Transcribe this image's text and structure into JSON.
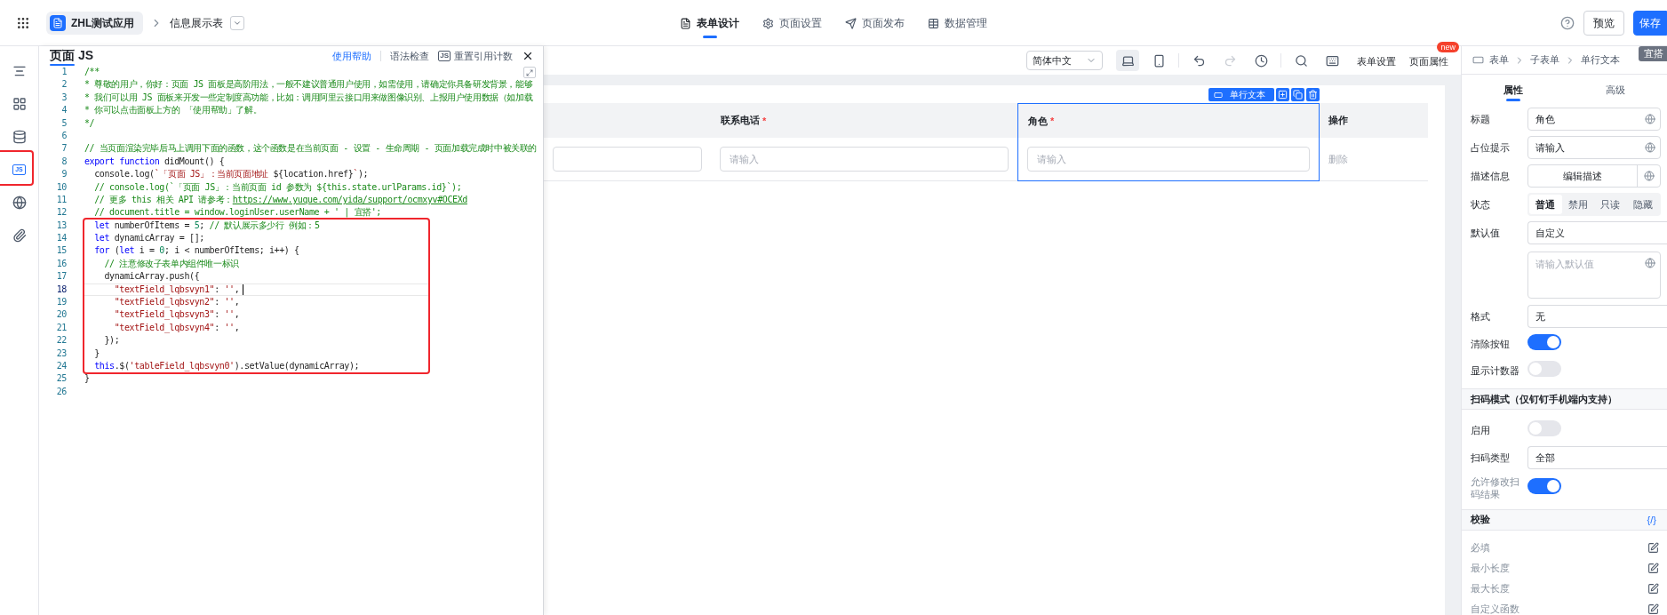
{
  "top_bar": {
    "app_name": "ZHL测试应用",
    "page_name": "信息展示表",
    "nav_tabs": [
      {
        "label": "表单设计",
        "selected": true
      },
      {
        "label": "页面设置",
        "selected": false
      },
      {
        "label": "页面发布",
        "selected": false
      },
      {
        "label": "数据管理",
        "selected": false
      }
    ],
    "buttons": [
      {
        "label": "预览",
        "kind": "secondary"
      },
      {
        "label": "保存",
        "kind": "primary"
      }
    ],
    "tag": "宜搭"
  },
  "rail": [
    {
      "kind": "outline",
      "selected": false,
      "highlighted": false
    },
    {
      "kind": "components",
      "selected": false,
      "highlighted": false
    },
    {
      "kind": "datasource",
      "selected": false,
      "highlighted": false
    },
    {
      "kind": "js",
      "label": "JS",
      "selected": true,
      "highlighted": true
    },
    {
      "kind": "i18n",
      "selected": false,
      "highlighted": false
    },
    {
      "kind": "attachment",
      "selected": false,
      "highlighted": false
    }
  ],
  "code_panel": {
    "title": "页面 JS",
    "actions": [
      {
        "kind": "link",
        "label": "使用帮助"
      },
      {
        "kind": "button",
        "label": "语法检查"
      },
      {
        "kind": "icon_button",
        "label": "重置引用计数",
        "icon_text": "JS"
      },
      {
        "kind": "close"
      }
    ],
    "lines": [
      {
        "number": "1",
        "boxed": false,
        "current": false,
        "tokens": [
          {
            "kind": "comment",
            "text": "/**"
          }
        ]
      },
      {
        "number": "2",
        "boxed": false,
        "current": false,
        "tokens": [
          {
            "kind": "comment",
            "text": "* 尊敬的用户，你好：页面 JS 面板是高阶用法，一般不建议普通用户使用，如需使用，请确定你具备研发背景，能够"
          }
        ]
      },
      {
        "number": "3",
        "boxed": false,
        "current": false,
        "tokens": [
          {
            "kind": "comment",
            "text": "* 我们可以用 JS 面板来开发一些定制度高功能，比如：调用阿里云接口用来做图像识别、上报用户使用数据（如加载"
          }
        ]
      },
      {
        "number": "4",
        "boxed": false,
        "current": false,
        "tokens": [
          {
            "kind": "comment",
            "text": "* 你可以点击面板上方的 「使用帮助」了解。"
          }
        ]
      },
      {
        "number": "5",
        "boxed": false,
        "current": false,
        "tokens": [
          {
            "kind": "comment",
            "text": "*/"
          }
        ]
      },
      {
        "number": "6",
        "boxed": false,
        "current": false
      },
      {
        "number": "7",
        "boxed": false,
        "current": false,
        "tokens": [
          {
            "kind": "comment",
            "text": "// 当页面渲染完毕后马上调用下面的函数，这个函数是在当前页面 - 设置 - 生命周期 - 页面加载完成时中被关联的"
          }
        ]
      },
      {
        "number": "8",
        "boxed": false,
        "current": false,
        "tokens": [
          {
            "kind": "keyword",
            "text": "export function"
          },
          {
            "kind": "plain",
            "text": " didMount() {"
          }
        ]
      },
      {
        "number": "9",
        "boxed": false,
        "current": false,
        "tokens": [
          {
            "kind": "plain",
            "text": "  console.log("
          },
          {
            "kind": "string",
            "text": "`「页面 JS」：当前页面地址 "
          },
          {
            "kind": "plain",
            "text": "${location.href}"
          },
          {
            "kind": "string",
            "text": "`"
          },
          {
            "kind": "plain",
            "text": ");"
          }
        ]
      },
      {
        "number": "10",
        "boxed": false,
        "current": false,
        "tokens": [
          {
            "kind": "comment",
            "text": "  // console.log(`「页面 JS」：当前页面 id 参数为 ${this.state.urlParams.id}`);"
          }
        ]
      },
      {
        "number": "11",
        "boxed": false,
        "current": false,
        "tokens": [
          {
            "kind": "comment",
            "text": "  // 更多 this 相关 API 请参考："
          },
          {
            "kind": "link",
            "text": "https://www.yuque.com/yida/support/ocmxyv#OCEXd"
          }
        ]
      },
      {
        "number": "12",
        "boxed": false,
        "current": false,
        "tokens": [
          {
            "kind": "comment",
            "text": "  // document.title = window.loginUser.userName + ' | 宜搭';"
          }
        ]
      },
      {
        "number": "13",
        "boxed": true,
        "current": false,
        "tokens": [
          {
            "kind": "keyword",
            "text": "  let"
          },
          {
            "kind": "plain",
            "text": " numberOfItems = "
          },
          {
            "kind": "number",
            "text": "5"
          },
          {
            "kind": "plain",
            "text": "; "
          },
          {
            "kind": "comment",
            "text": "// 默认展示多少行 例如：5"
          }
        ]
      },
      {
        "number": "14",
        "boxed": true,
        "current": false,
        "tokens": [
          {
            "kind": "keyword",
            "text": "  let"
          },
          {
            "kind": "plain",
            "text": " dynamicArray = [];"
          }
        ]
      },
      {
        "number": "15",
        "boxed": true,
        "current": false,
        "tokens": [
          {
            "kind": "keyword",
            "text": "  for"
          },
          {
            "kind": "plain",
            "text": " ("
          },
          {
            "kind": "keyword",
            "text": "let"
          },
          {
            "kind": "plain",
            "text": " i = "
          },
          {
            "kind": "number",
            "text": "0"
          },
          {
            "kind": "plain",
            "text": "; i < numberOfItems; i++) {"
          }
        ]
      },
      {
        "number": "16",
        "boxed": true,
        "current": false,
        "tokens": [
          {
            "kind": "comment",
            "text": "    // 注意修改子表单内组件唯一标识"
          }
        ]
      },
      {
        "number": "17",
        "boxed": true,
        "current": false,
        "tokens": [
          {
            "kind": "plain",
            "text": "    dynamicArray.push({"
          }
        ]
      },
      {
        "number": "18",
        "boxed": true,
        "current": true,
        "tokens": [
          {
            "kind": "string",
            "text": "      \"textField_lqbsvyn1\""
          },
          {
            "kind": "plain",
            "text": ": "
          },
          {
            "kind": "string",
            "text": "''"
          },
          {
            "kind": "plain",
            "text": ","
          }
        ]
      },
      {
        "number": "19",
        "boxed": true,
        "current": false,
        "tokens": [
          {
            "kind": "string",
            "text": "      \"textField_lqbsvyn2\""
          },
          {
            "kind": "plain",
            "text": ": "
          },
          {
            "kind": "string",
            "text": "''"
          },
          {
            "kind": "plain",
            "text": ","
          }
        ]
      },
      {
        "number": "20",
        "boxed": true,
        "current": false,
        "tokens": [
          {
            "kind": "string",
            "text": "      \"textField_lqbsvyn3\""
          },
          {
            "kind": "plain",
            "text": ": "
          },
          {
            "kind": "string",
            "text": "''"
          },
          {
            "kind": "plain",
            "text": ","
          }
        ]
      },
      {
        "number": "21",
        "boxed": true,
        "current": false,
        "tokens": [
          {
            "kind": "string",
            "text": "      \"textField_lqbsvyn4\""
          },
          {
            "kind": "plain",
            "text": ": "
          },
          {
            "kind": "string",
            "text": "''"
          },
          {
            "kind": "plain",
            "text": ","
          }
        ]
      },
      {
        "number": "22",
        "boxed": true,
        "current": false,
        "tokens": [
          {
            "kind": "plain",
            "text": "    });"
          }
        ]
      },
      {
        "number": "23",
        "boxed": true,
        "current": false,
        "tokens": [
          {
            "kind": "plain",
            "text": "  }"
          }
        ]
      },
      {
        "number": "24",
        "boxed": true,
        "current": false,
        "tokens": [
          {
            "kind": "keyword",
            "text": "  this"
          },
          {
            "kind": "plain",
            "text": ".$("
          },
          {
            "kind": "string",
            "text": "'tableField_lqbsvyn0'"
          },
          {
            "kind": "plain",
            "text": ").setValue(dynamicArray);"
          }
        ]
      },
      {
        "number": "25",
        "boxed": false,
        "current": false,
        "tokens": [
          {
            "kind": "plain",
            "text": "}"
          }
        ]
      },
      {
        "number": "26",
        "boxed": false,
        "current": false
      }
    ]
  },
  "canvas": {
    "toolbar": {
      "language": "简体中文",
      "devices": [
        {
          "kind": "desktop",
          "selected": true
        },
        {
          "kind": "mobile",
          "selected": false
        }
      ],
      "history": [
        {
          "kind": "undo",
          "disabled": false
        },
        {
          "kind": "redo",
          "disabled": true
        },
        {
          "kind": "history",
          "disabled": false
        }
      ],
      "tools": [
        {
          "kind": "search"
        },
        {
          "kind": "shortcut"
        }
      ],
      "links": [
        {
          "label": "表单设置"
        },
        {
          "label": "页面属性",
          "badge": "new"
        }
      ]
    },
    "field_toolbar": {
      "label": "单行文本",
      "actions": [
        {
          "kind": "add"
        },
        {
          "kind": "copy"
        },
        {
          "kind": "delete"
        }
      ]
    },
    "table": {
      "columns": [
        {
          "kind": "field",
          "selected": false
        },
        {
          "kind": "field",
          "label": "联系电话",
          "required_mark": "*",
          "selected": false
        },
        {
          "kind": "field",
          "label": "角色",
          "required_mark": "*",
          "selected": true
        },
        {
          "kind": "action",
          "label": "操作",
          "selected": false
        }
      ],
      "rows": [
        {
          "cells": [
            {
              "kind": "input"
            },
            {
              "kind": "input",
              "placeholder": "请输入"
            },
            {
              "kind": "input",
              "placeholder": "请输入"
            },
            {
              "kind": "action",
              "text": "删除"
            }
          ]
        }
      ]
    }
  },
  "properties": {
    "breadcrumb": [
      "表单",
      "子表单",
      "单行文本"
    ],
    "tabs": [
      {
        "label": "属性",
        "selected": true
      },
      {
        "label": "高级",
        "selected": false
      }
    ],
    "rows": [
      {
        "kind": "input",
        "label": "标题",
        "value": "角色",
        "i18n": true
      },
      {
        "kind": "input",
        "label": "占位提示",
        "value": "请输入",
        "i18n": true
      },
      {
        "kind": "button",
        "label": "描述信息",
        "value": "编辑描述",
        "i18n": true
      },
      {
        "kind": "segmented",
        "label": "状态",
        "options": [
          {
            "label": "普通",
            "selected": true
          },
          {
            "label": "禁用",
            "selected": false
          },
          {
            "label": "只读",
            "selected": false
          },
          {
            "label": "隐藏",
            "selected": false
          }
        ]
      },
      {
        "kind": "select",
        "label": "默认值",
        "value": "自定义"
      },
      {
        "kind": "textarea",
        "placeholder": "请输入默认值",
        "i18n": true
      },
      {
        "kind": "select",
        "label": "格式",
        "value": "无"
      },
      {
        "kind": "switch",
        "label": "清除按钮",
        "on": true,
        "muted": false
      },
      {
        "kind": "switch",
        "label": "显示计数器",
        "on": false,
        "muted": false
      },
      {
        "kind": "section",
        "label": "扫码模式（仅钉钉手机端内支持）"
      },
      {
        "kind": "switch",
        "label": "启用",
        "on": false,
        "muted": false
      },
      {
        "kind": "select",
        "label": "扫码类型",
        "value": "全部"
      },
      {
        "kind": "switch",
        "label": "允许修改扫码结果",
        "on": true,
        "muted": true
      },
      {
        "kind": "section",
        "label": "校验",
        "action": "{/}"
      },
      {
        "kind": "rule",
        "label": "必填"
      },
      {
        "kind": "rule",
        "label": "最小长度"
      },
      {
        "kind": "rule",
        "label": "最大长度"
      },
      {
        "kind": "rule",
        "label": "自定义函数"
      }
    ]
  }
}
